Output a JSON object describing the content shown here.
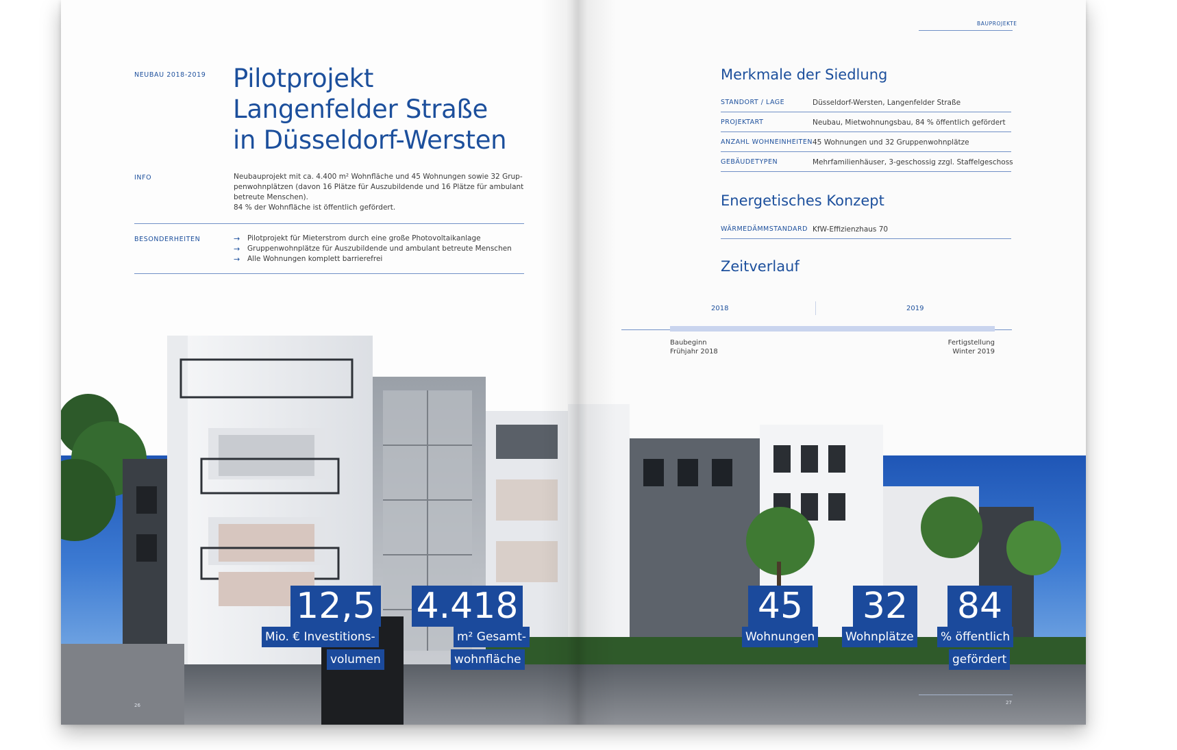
{
  "left": {
    "section_label": "NEUBAU 2018-2019",
    "title_lines": [
      "Pilotprojekt",
      "Langenfelder Straße",
      "in Düsseldorf-Wersten"
    ],
    "info_label": "INFO",
    "info_lines": [
      "Neubauprojekt mit ca. 4.400 m² Wohnfläche und 45 Wohnungen sowie 32 Grup-",
      "penwohnplätzen (davon 16 Plätze für Auszubildende und 16 Plätze für ambulant",
      "betreute Menschen).",
      "84 % der Wohnfläche ist öffentlich gefördert."
    ],
    "besonderheiten_label": "BESONDERHEITEN",
    "besonderheiten": [
      "Pilotprojekt für Mieterstrom durch eine große Photovoltaikanlage",
      "Gruppenwohnplätze für Auszubildende und ambulant betreute Menschen",
      "Alle Wohnungen komplett barrierefrei"
    ],
    "page_number": "26"
  },
  "right": {
    "header_label": "BAUPROJEKTE",
    "merkmale_title": "Merkmale der Siedlung",
    "merkmale": [
      {
        "key": "STANDORT / LAGE",
        "value": "Düsseldorf-Wersten, Langenfelder Straße"
      },
      {
        "key": "PROJEKTART",
        "value": "Neubau, Mietwohnungsbau, 84 % öffentlich gefördert"
      },
      {
        "key": "ANZAHL WOHNEINHEITEN",
        "value": "45 Wohnungen und 32 Gruppenwohnplätze"
      },
      {
        "key": "GEBÄUDETYPEN",
        "value": "Mehrfamilienhäuser, 3-geschossig zzgl. Staffelgeschoss"
      }
    ],
    "energie_title": "Energetisches Konzept",
    "energie": [
      {
        "key": "WÄRMEDÄMMSTANDARD",
        "value": "KfW-Effizienzhaus 70"
      }
    ],
    "zeit_title": "Zeitverlauf",
    "timeline": {
      "years": [
        "2018",
        "2019"
      ],
      "start_label": [
        "Baubeginn",
        "Frühjahr 2018"
      ],
      "end_label": [
        "Fertigstellung",
        "Winter 2019"
      ],
      "progress": 1.0
    },
    "page_number": "27"
  },
  "stats": [
    {
      "number": "12,5",
      "label_lines": [
        "Mio. € Investitions-",
        "volumen"
      ]
    },
    {
      "number": "4.418",
      "label_lines": [
        "m² Gesamt-",
        "wohnfläche"
      ]
    },
    {
      "number": "45",
      "label_lines": [
        "Wohnungen"
      ]
    },
    {
      "number": "32",
      "label_lines": [
        "Wohnplätze"
      ]
    },
    {
      "number": "84",
      "label_lines": [
        "% öffentlich",
        "gefördert"
      ]
    }
  ],
  "colors": {
    "accent": "#1c4f9c",
    "stat_box": "#1b4a9c",
    "sky": "#2f68c4",
    "rule": "#6f8fc6"
  }
}
